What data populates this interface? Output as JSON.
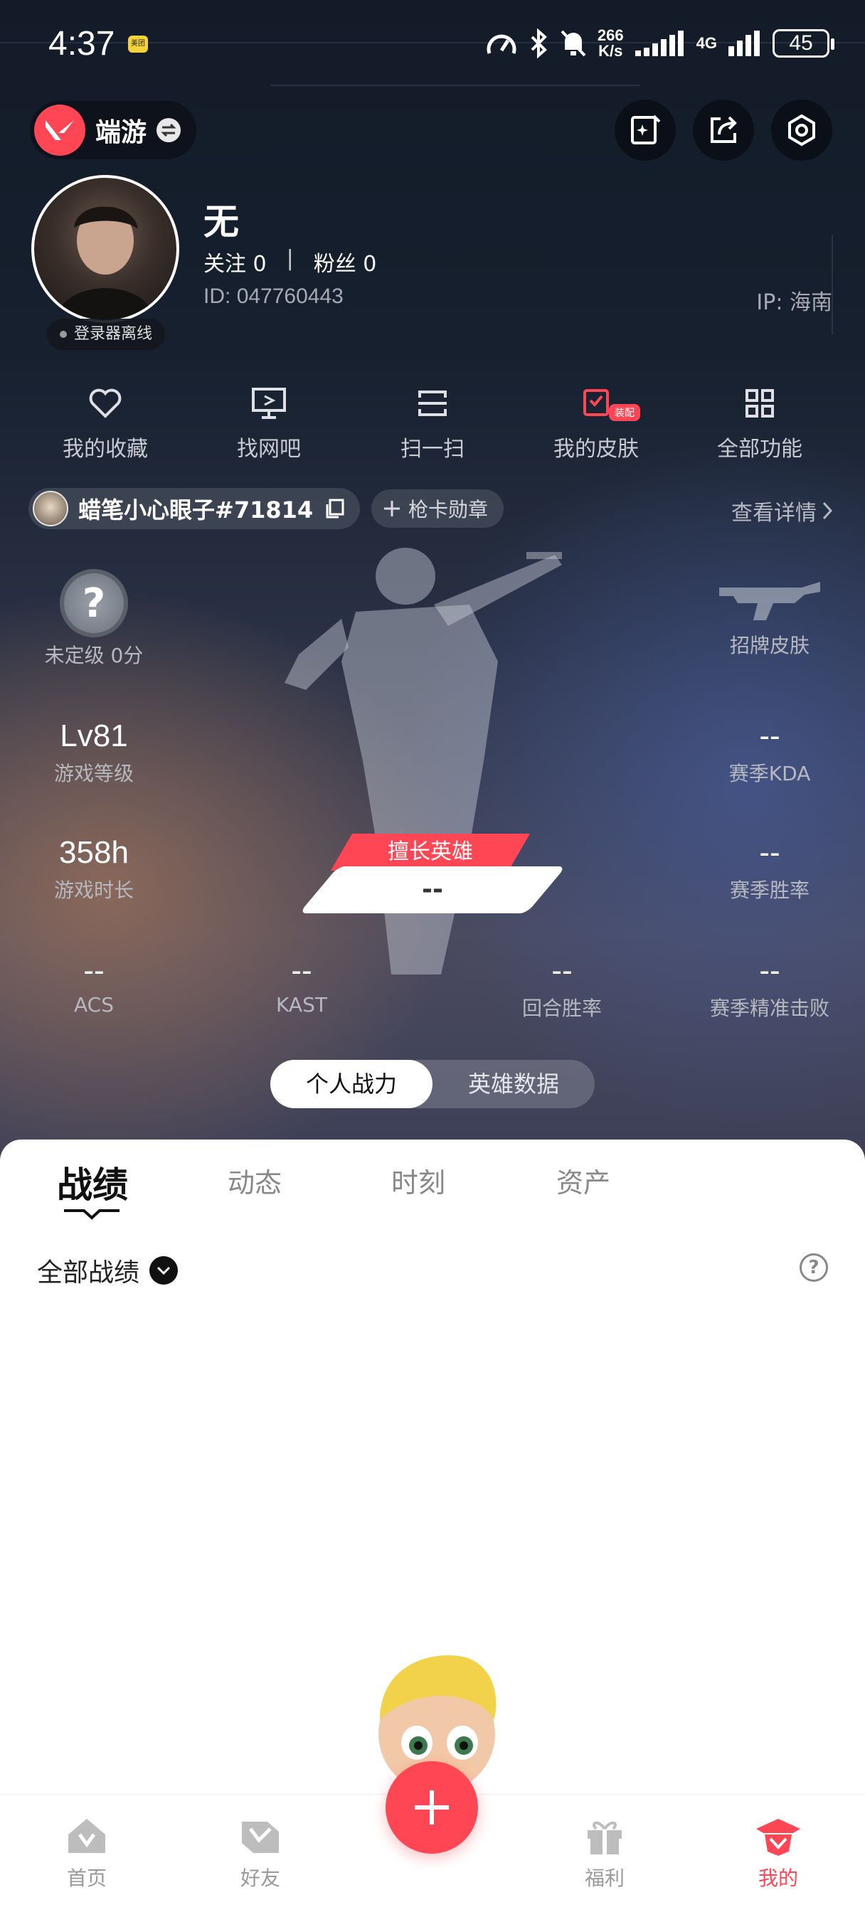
{
  "status_bar": {
    "time": "4:37",
    "notification_badge": "美团",
    "net_speed_value": "266",
    "net_speed_unit": "K/s",
    "network": "4G",
    "battery": "45"
  },
  "header": {
    "game_name": "端游",
    "actions": [
      "card-edit-icon",
      "share-icon",
      "settings-icon"
    ]
  },
  "profile": {
    "username": "无",
    "following_label": "关注",
    "following_count": "0",
    "followers_label": "粉丝",
    "followers_count": "0",
    "id_label": "ID:",
    "id_value": "047760443",
    "ip_label": "IP:",
    "ip_value": "海南",
    "status": "登录器离线"
  },
  "quick_actions": [
    {
      "label": "我的收藏",
      "icon": "heart-icon"
    },
    {
      "label": "找网吧",
      "icon": "monitor-icon"
    },
    {
      "label": "扫一扫",
      "icon": "scan-icon"
    },
    {
      "label": "我的皮肤",
      "icon": "skin-icon",
      "tag": "装配"
    },
    {
      "label": "全部功能",
      "icon": "grid-icon"
    }
  ],
  "riot": {
    "riot_id": "蜡笔小心眼子#71814",
    "badge_label": "枪卡勋章",
    "details_label": "查看详情"
  },
  "stats": {
    "rank_label": "未定级 0分",
    "signature_skin_label": "招牌皮肤",
    "level_value": "Lv81",
    "level_label": "游戏等级",
    "kda_value": "--",
    "kda_label": "赛季KDA",
    "playtime_value": "358h",
    "playtime_label": "游戏时长",
    "winrate_value": "--",
    "winrate_label": "赛季胜率",
    "best_hero_tag": "擅长英雄",
    "best_hero_value": "--",
    "acs_value": "--",
    "acs_label": "ACS",
    "kast_value": "--",
    "kast_label": "KAST",
    "round_winrate_value": "--",
    "round_winrate_label": "回合胜率",
    "precision_value": "--",
    "precision_label": "赛季精准击败"
  },
  "segment": {
    "options": [
      "个人战力",
      "英雄数据"
    ],
    "selected": "个人战力"
  },
  "tabs": [
    "战绩",
    "动态",
    "时刻",
    "资产"
  ],
  "active_tab": "战绩",
  "filter": {
    "label": "全部战绩"
  },
  "bottom_nav": [
    {
      "label": "首页",
      "icon": "home-icon"
    },
    {
      "label": "好友",
      "icon": "friends-icon"
    },
    {
      "label": "",
      "icon": "add-icon"
    },
    {
      "label": "福利",
      "icon": "gift-icon"
    },
    {
      "label": "我的",
      "icon": "profile-icon"
    }
  ],
  "colors": {
    "accent": "#ff4655",
    "hero_top": "#131b28",
    "panel_bg": "#ffffff"
  }
}
